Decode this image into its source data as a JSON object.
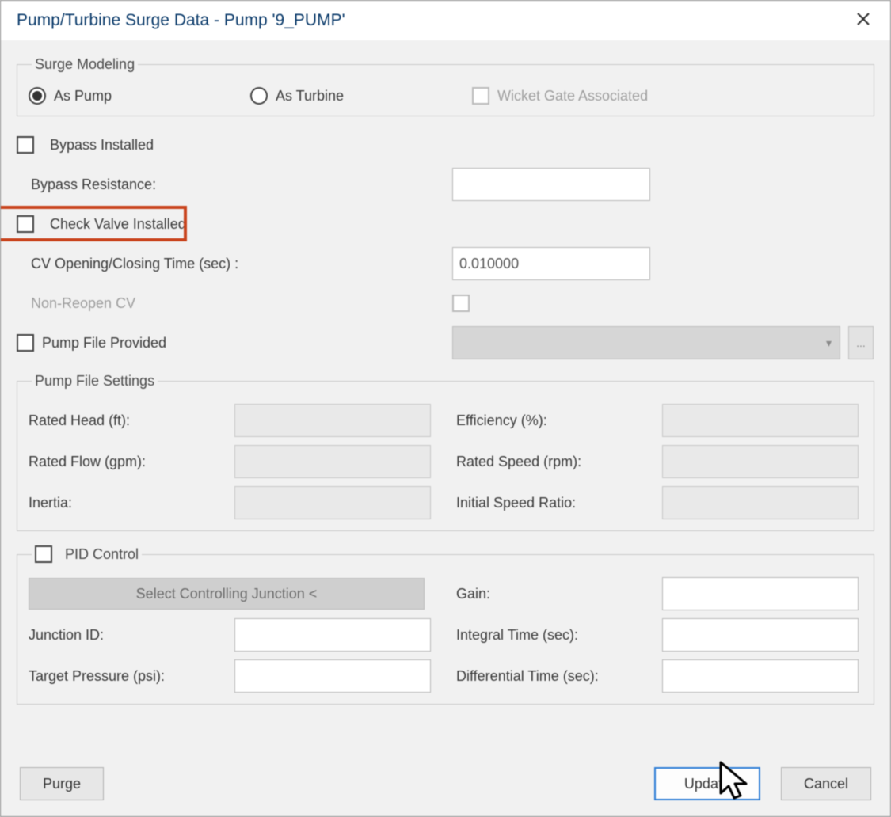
{
  "title": "Pump/Turbine Surge Data - Pump '9_PUMP'",
  "surge_modeling": {
    "legend": "Surge Modeling",
    "as_pump": "As Pump",
    "as_turbine": "As Turbine",
    "wicket": "Wicket Gate Associated"
  },
  "bypass": {
    "installed": "Bypass Installed",
    "resistance": "Bypass Resistance:",
    "resistance_value": ""
  },
  "check_valve": {
    "installed": "Check Valve Installed",
    "cv_time_label": "CV Opening/Closing Time (sec) :",
    "cv_time_value": "0.010000",
    "non_reopen": "Non-Reopen CV"
  },
  "pump_file": {
    "provided": "Pump File Provided",
    "browse": "..."
  },
  "pump_file_settings": {
    "legend": "Pump File Settings",
    "rated_head": "Rated Head (ft):",
    "rated_flow": "Rated Flow (gpm):",
    "inertia": "Inertia:",
    "efficiency": "Efficiency (%):",
    "rated_speed": "Rated Speed (rpm):",
    "initial_speed_ratio": "Initial Speed Ratio:"
  },
  "pid": {
    "legend": "PID Control",
    "select_junction": "Select Controlling Junction <",
    "junction_id": "Junction ID:",
    "target_pressure": "Target Pressure (psi):",
    "gain": "Gain:",
    "integral_time": "Integral Time (sec):",
    "diff_time": "Differential Time (sec):"
  },
  "buttons": {
    "purge": "Purge",
    "update": "Update",
    "cancel": "Cancel"
  }
}
